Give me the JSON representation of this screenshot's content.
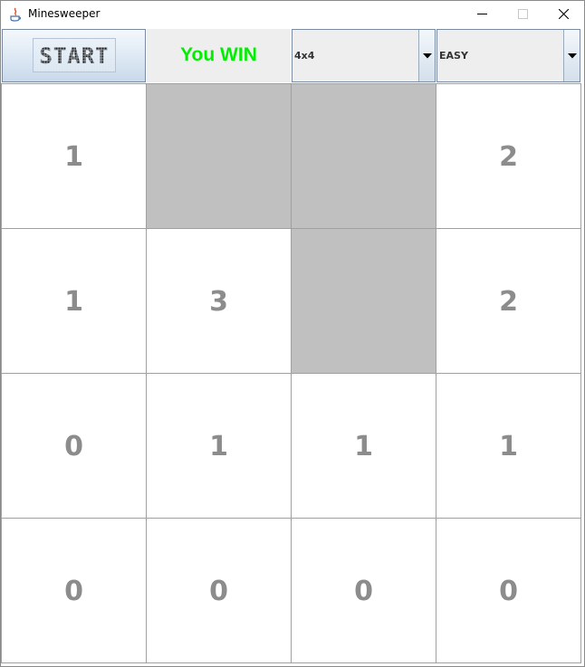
{
  "window": {
    "title": "Minesweeper",
    "controls": [
      "minimize-icon",
      "maximize-icon",
      "close-icon"
    ]
  },
  "toolbar": {
    "start_label": "START",
    "status_text": "You WIN",
    "status_color": "#00ee00",
    "size_select": {
      "selected": "4x4"
    },
    "difficulty_select": {
      "selected": "EASY"
    }
  },
  "board": {
    "rows": 4,
    "cols": 4,
    "cells": [
      [
        "1",
        "",
        "",
        "2"
      ],
      [
        "1",
        "3",
        "",
        "2"
      ],
      [
        "0",
        "1",
        "1",
        "1"
      ],
      [
        "0",
        "0",
        "0",
        "0"
      ]
    ],
    "hidden": [
      [
        false,
        true,
        true,
        false
      ],
      [
        false,
        false,
        true,
        false
      ],
      [
        false,
        false,
        false,
        false
      ],
      [
        false,
        false,
        false,
        false
      ]
    ],
    "number_color": "#8c8c8c",
    "hidden_color": "#c0c0c0"
  }
}
